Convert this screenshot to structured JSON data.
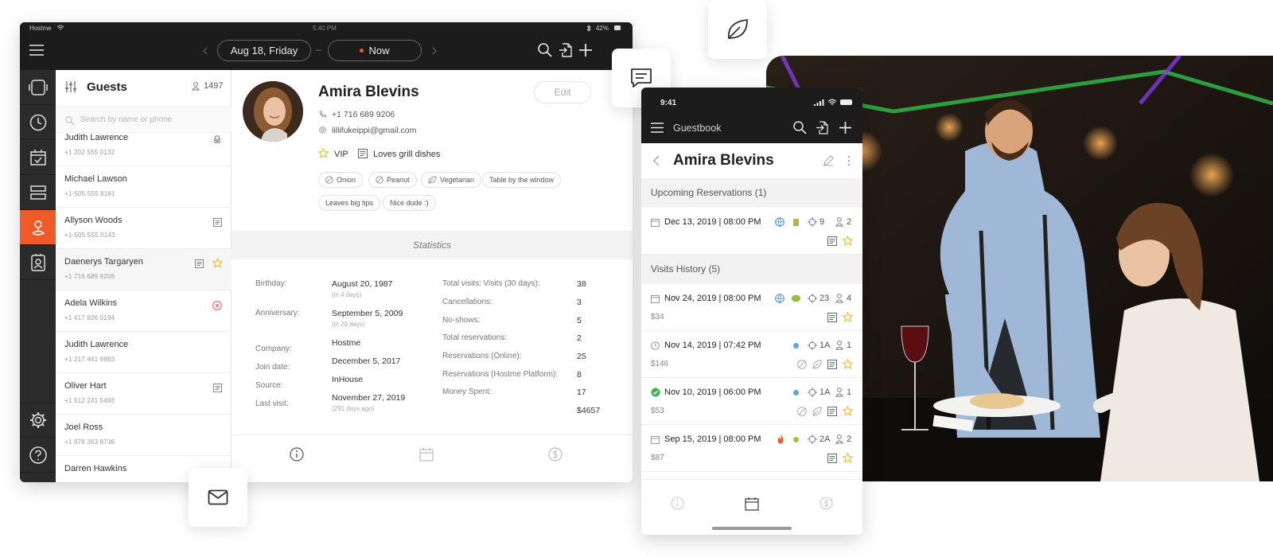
{
  "tablet": {
    "status": {
      "carrier": "Hostme",
      "time": "5:40 PM",
      "battery": "42%"
    },
    "date_pill": "Aug 18, Friday",
    "dash": "–",
    "now_pill": "Now",
    "guests": {
      "title": "Guests",
      "count": "1497",
      "search_placeholder": "Search by name or phone",
      "rows": [
        {
          "name": "Judith Lawrence",
          "phone": "+1 202 555 0132"
        },
        {
          "name": "Michael Lawson",
          "phone": "+1-505 555 8161"
        },
        {
          "name": "Allyson Woods",
          "phone": "+1-505 555 0143"
        },
        {
          "name": "Daenerys Targaryen",
          "phone": "+1 716 689 9206"
        },
        {
          "name": "Adela Wilkins",
          "phone": "+1 417 826 0194"
        },
        {
          "name": "Judith Lawrence",
          "phone": "+1 217 441 9883"
        },
        {
          "name": "Oliver Hart",
          "phone": "+1 512 241 5493"
        },
        {
          "name": "Joel Ross",
          "phone": "+1 978 363 6736"
        },
        {
          "name": "Darren Hawkins",
          "phone": ""
        }
      ]
    },
    "profile": {
      "name": "Amira Blevins",
      "edit": "Edit",
      "phone": "+1 716 689 9206",
      "email": "lillifukeippi@gmail.com",
      "vip": "VIP",
      "note": "Loves grill dishes",
      "chips": [
        "Onion",
        "Peanut",
        "Vegetarian",
        "Table by the window",
        "Leaves big tips",
        "Nice dude :)"
      ],
      "statistics_header": "Statistics",
      "left_stats": {
        "birthday_label": "Birthday:",
        "birthday_value": "August 20, 1987",
        "birthday_sub": "(in 4 days)",
        "anniversary_label": "Anniversary:",
        "anniversary_value": "September 5, 2009",
        "anniversary_sub": "(in 20 days)",
        "company_label": "Company:",
        "company_value": "Hostme",
        "join_label": "Join date:",
        "join_value": "December 5, 2017",
        "source_label": "Source:",
        "source_value": "InHouse",
        "last_label": "Last visit:",
        "last_value": "November 27, 2019",
        "last_sub": "(291 days ago)"
      },
      "right_stats": [
        {
          "label": "Total visits: Visits (30 days):",
          "value": "38"
        },
        {
          "label": "Cancellations:",
          "value": "3"
        },
        {
          "label": "No-shows:",
          "value": "5"
        },
        {
          "label": "Total reservations:",
          "value": "2"
        },
        {
          "label": "Reservations (Online):",
          "value": "25"
        },
        {
          "label": "Reservations (Hostme Platform):",
          "value": "8"
        },
        {
          "label": "Money Spent:",
          "value": "17"
        },
        {
          "label": "",
          "value": "$4657"
        }
      ]
    }
  },
  "phone": {
    "time": "9:41",
    "title": "Guestbook",
    "guest_name": "Amira Blevins",
    "upcoming_header": "Upcoming Reservations (1)",
    "upcoming": [
      {
        "date": "Dec 13, 2019 | 08:00 PM",
        "table": "9",
        "guests": "2"
      }
    ],
    "history_header": "Visits History (5)",
    "history": [
      {
        "date": "Nov 24, 2019 | 08:00 PM",
        "table": "23",
        "guests": "4",
        "amount": "$34"
      },
      {
        "date": "Nov 14, 2019 | 07:42 PM",
        "table": "1A",
        "guests": "1",
        "amount": "$146"
      },
      {
        "date": "Nov 10, 2019 | 06:00 PM",
        "table": "1A",
        "guests": "1",
        "amount": "$53"
      },
      {
        "date": "Sep 15, 2019 | 08:00 PM",
        "table": "2A",
        "guests": "2",
        "amount": "$87"
      }
    ]
  },
  "colors": {
    "accent": "#f05a28",
    "dark": "#1c1c1c",
    "star": "#e8b82a"
  }
}
